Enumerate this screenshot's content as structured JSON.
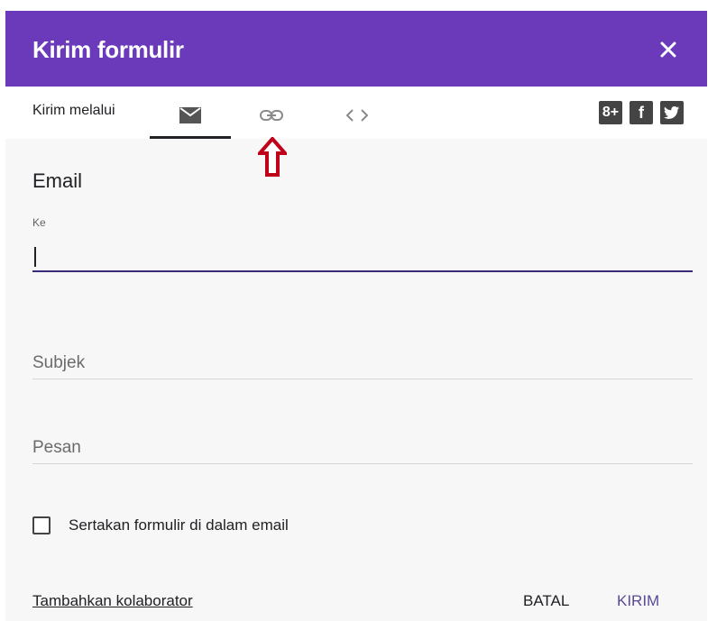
{
  "dialog": {
    "title": "Kirim formulir",
    "close_icon": "close-icon",
    "send_via_label": "Kirim melalui",
    "tabs": [
      {
        "id": "email",
        "icon": "mail-icon",
        "selected": true
      },
      {
        "id": "link",
        "icon": "link-icon",
        "selected": false
      },
      {
        "id": "embed",
        "icon": "code-icon",
        "selected": false
      }
    ],
    "social": [
      {
        "icon": "google-plus-icon",
        "glyph": "8+"
      },
      {
        "icon": "facebook-icon",
        "glyph": "f"
      },
      {
        "icon": "twitter-icon"
      }
    ],
    "annotation_arrow": "red-arrow-icon"
  },
  "email": {
    "section_title": "Email",
    "to_label": "Ke",
    "to_value": "",
    "subject_placeholder": "Subjek",
    "message_placeholder": "Pesan",
    "include_form_label": "Sertakan formulir di dalam email",
    "include_form_checked": false
  },
  "footer": {
    "add_collaborators": "Tambahkan kolaborator",
    "cancel": "BATAL",
    "send": "KIRIM"
  },
  "colors": {
    "header": "#6a3aba",
    "arrow": "#c0001a",
    "send_button": "#5a4a98"
  }
}
